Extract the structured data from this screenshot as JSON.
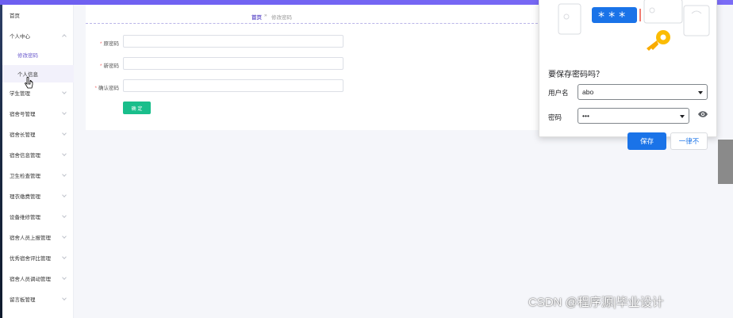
{
  "sidebar": {
    "items": [
      {
        "label": "首页"
      },
      {
        "label": "个人中心"
      },
      {
        "label": "修改密码"
      },
      {
        "label": "个人信息"
      },
      {
        "label": "学生管理"
      },
      {
        "label": "宿舍号管理"
      },
      {
        "label": "宿舍长管理"
      },
      {
        "label": "宿舍信息管理"
      },
      {
        "label": "卫生检查管理"
      },
      {
        "label": "理衣缴费管理"
      },
      {
        "label": "设备维修管理"
      },
      {
        "label": "宿舍人员上报管理"
      },
      {
        "label": "优秀宿舍评比管理"
      },
      {
        "label": "宿舍人员调动管理"
      },
      {
        "label": "留言板管理"
      }
    ]
  },
  "breadcrumb": {
    "home": "首页",
    "separator": "»",
    "current": "修改密码"
  },
  "form": {
    "required_mark": "*",
    "old_password_label": "原密码",
    "new_password_label": "新密码",
    "confirm_password_label": "确认密码",
    "submit_label": "确 定"
  },
  "save_password_popup": {
    "title": "要保存密码吗？",
    "username_label": "用户名",
    "username_value": "abo",
    "password_label": "密码",
    "password_value": "•••",
    "illustration_text": "* * *",
    "save_label": "保存",
    "never_label": "一律不"
  },
  "watermark": "CSDN @程序源|毕业设计",
  "colors": {
    "accent": "#6a5acd",
    "confirm_button": "#19be8b",
    "save_button": "#1a73e8",
    "required": "#f56c6c"
  },
  "icons": [
    "chevron-down-icon",
    "hand-cursor-icon",
    "eye-icon",
    "key-icon",
    "dropdown-arrow-icon"
  ]
}
